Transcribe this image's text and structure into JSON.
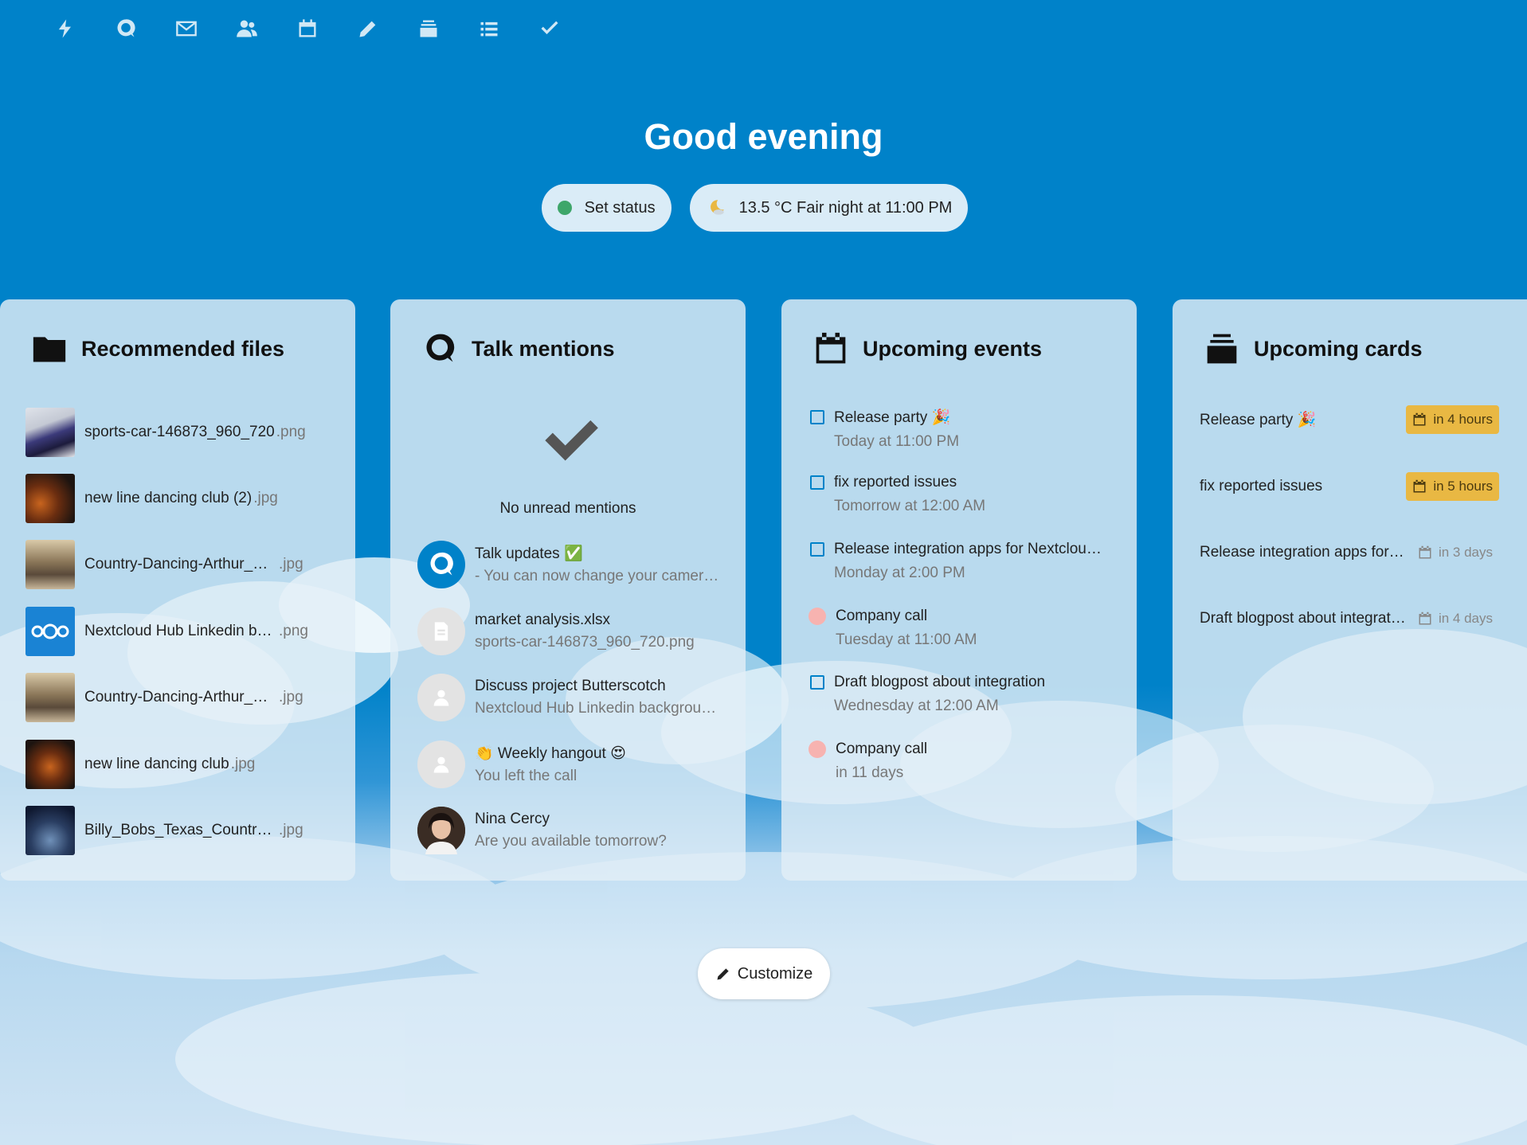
{
  "colors": {
    "primary": "#0082c9",
    "warn": "#e9b843",
    "online": "#3ea66a",
    "event_dot": "#f7b3b0"
  },
  "nav": [
    "activity-icon",
    "talk-icon",
    "mail-icon",
    "contacts-icon",
    "calendar-icon",
    "notes-icon",
    "deck-icon",
    "tasks-icon",
    "checkmark-icon"
  ],
  "greeting": "Good evening",
  "status": {
    "label": "Set status"
  },
  "weather": {
    "label": "13.5 °C Fair night at 11:00 PM"
  },
  "files": {
    "title": "Recommended files",
    "items": [
      {
        "name": "sports-car-146873_960_720",
        "ext": ".png"
      },
      {
        "name": "new line dancing club (2)",
        "ext": ".jpg"
      },
      {
        "name": "Country-Dancing-Arthur_Murray",
        "ext": ".jpg"
      },
      {
        "name": "Nextcloud Hub Linkedin background",
        "ext": ".png"
      },
      {
        "name": "Country-Dancing-Arthur_Murray",
        "ext": ".jpg"
      },
      {
        "name": "new line dancing club",
        "ext": ".jpg"
      },
      {
        "name": "Billy_Bobs_Texas_Country_Dance",
        "ext": ".jpg"
      }
    ]
  },
  "talk": {
    "title": "Talk mentions",
    "empty": "No unread mentions",
    "items": [
      {
        "title": "Talk updates ✅",
        "sub": "- You can now change your camera background"
      },
      {
        "title": "market analysis.xlsx",
        "sub": "sports-car-146873_960_720.png"
      },
      {
        "title": "Discuss project Butterscotch",
        "sub": "Nextcloud Hub Linkedin background.png"
      },
      {
        "title": "👏 Weekly hangout 😍",
        "sub": "You left the call"
      },
      {
        "title": "Nina Cercy",
        "sub": "Are you available tomorrow?"
      }
    ]
  },
  "events": {
    "title": "Upcoming events",
    "items": [
      {
        "title": "Release party 🎉",
        "sub": "Today at 11:00 PM",
        "kind": "task"
      },
      {
        "title": "fix reported issues",
        "sub": "Tomorrow at 12:00 AM",
        "kind": "task"
      },
      {
        "title": "Release integration apps for Nextcloud Hub",
        "sub": "Monday at 2:00 PM",
        "kind": "task"
      },
      {
        "title": "Company call",
        "sub": "Tuesday at 11:00 AM",
        "kind": "event"
      },
      {
        "title": "Draft blogpost about integration",
        "sub": "Wednesday at 12:00 AM",
        "kind": "task"
      },
      {
        "title": "Company call",
        "sub": "in 11 days",
        "kind": "event"
      }
    ]
  },
  "cards": {
    "title": "Upcoming cards",
    "items": [
      {
        "title": "Release party 🎉",
        "due": "in 4 hours",
        "urgent": true
      },
      {
        "title": "fix reported issues",
        "due": "in 5 hours",
        "urgent": true
      },
      {
        "title": "Release integration apps for Nextcloud Hub",
        "due": "in 3 days",
        "urgent": false
      },
      {
        "title": "Draft blogpost about integration",
        "due": "in 4 days",
        "urgent": false
      }
    ]
  },
  "customize": {
    "label": "Customize"
  }
}
